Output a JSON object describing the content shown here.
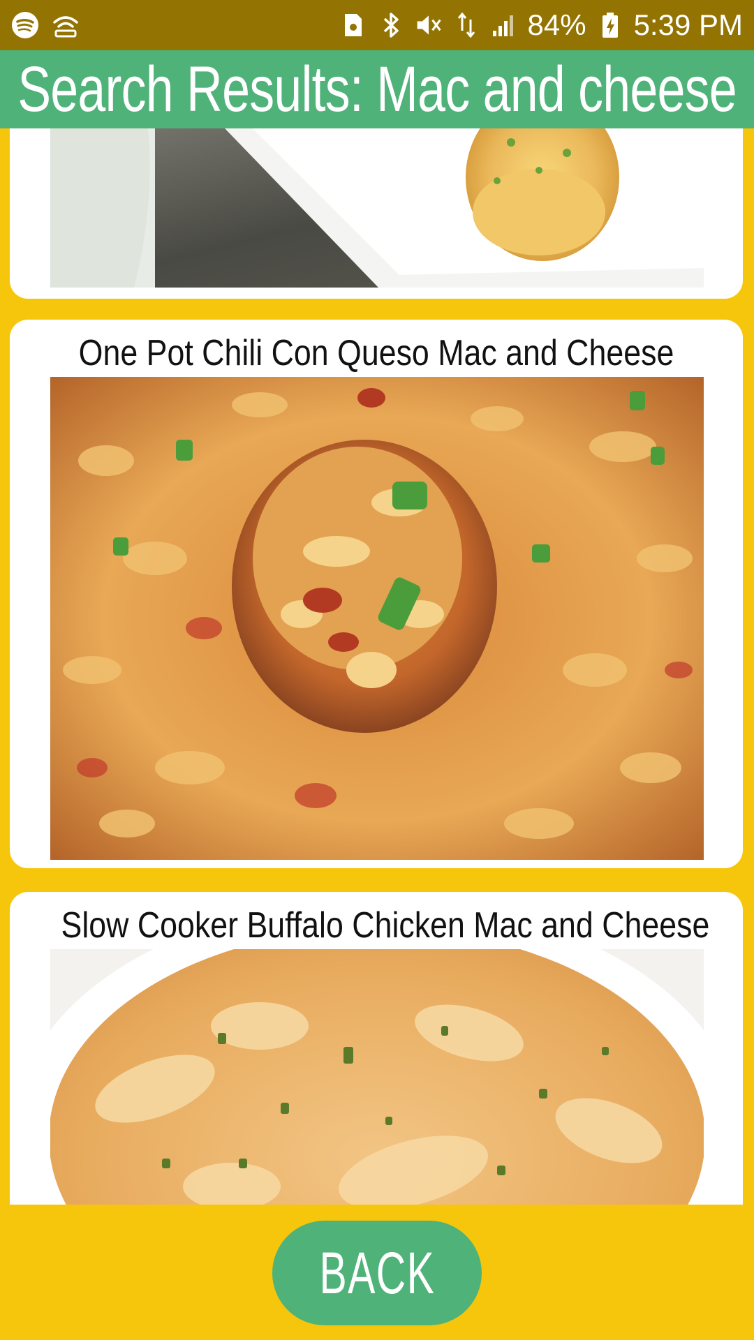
{
  "status_bar": {
    "battery_percent": "84%",
    "time": "5:39 PM",
    "left_icons": [
      "spotify-icon",
      "wifi-hotspot-icon"
    ],
    "right_icons": [
      "sim-card-icon",
      "bluetooth-icon",
      "mute-icon",
      "data-icon",
      "signal-icon",
      "battery-charging-icon"
    ]
  },
  "header": {
    "title": "Search Results: Mac and cheese"
  },
  "results": [
    {
      "title": "",
      "image_desc": "mini mac and cheese cup on white plate"
    },
    {
      "title": "One Pot Chili Con Queso Mac and Cheese",
      "image_desc": "spoonful of chili mac and cheese with green onions"
    },
    {
      "title": "Slow Cooker Buffalo Chicken Mac and Cheese",
      "image_desc": "creamy buffalo chicken shells in white bowl"
    }
  ],
  "footer": {
    "back_label": "BACK"
  },
  "colors": {
    "background": "#F6C60C",
    "status_bar": "#937402",
    "accent_green": "#4EB279",
    "card": "#FFFFFF"
  }
}
